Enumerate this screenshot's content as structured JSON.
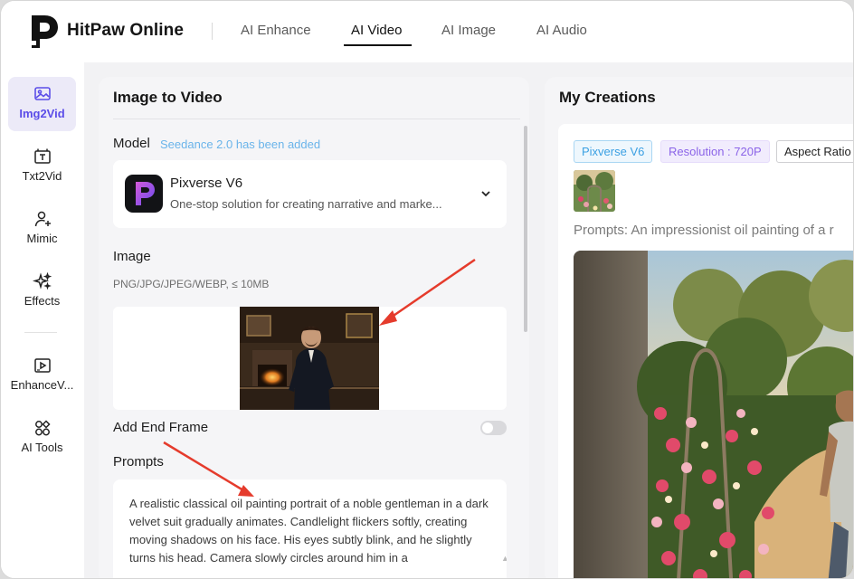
{
  "header": {
    "brand": "HitPaw Online",
    "tabs": [
      {
        "label": "AI Enhance"
      },
      {
        "label": "AI Video"
      },
      {
        "label": "AI Image"
      },
      {
        "label": "AI Audio"
      }
    ],
    "active_tab": "AI Video"
  },
  "sidebar": {
    "items": [
      {
        "label": "Img2Vid",
        "icon": "image-icon"
      },
      {
        "label": "Txt2Vid",
        "icon": "text-frame-icon"
      },
      {
        "label": "Mimic",
        "icon": "person-sparkle-icon"
      },
      {
        "label": "Effects",
        "icon": "sparkles-icon"
      },
      {
        "label": "EnhanceV...",
        "icon": "hd-video-icon"
      },
      {
        "label": "AI Tools",
        "icon": "tools-grid-icon"
      }
    ],
    "active_item": "Img2Vid"
  },
  "image_to_video": {
    "title": "Image to Video",
    "model_label": "Model",
    "model_note": "Seedance 2.0 has been added",
    "model": {
      "name": "Pixverse V6",
      "description": "One-stop solution for creating narrative and marke..."
    },
    "image_label": "Image",
    "image_hint": "PNG/JPG/JPEG/WEBP, ≤ 10MB",
    "end_frame_label": "Add End Frame",
    "end_frame_enabled": false,
    "prompts_label": "Prompts",
    "prompt_text": "A realistic classical oil painting portrait of a noble gentleman in a dark velvet suit gradually animates. Candlelight flickers softly, creating moving shadows on his face. His eyes subtly blink, and he slightly turns his head. Camera slowly circles around him in a"
  },
  "my_creations": {
    "title": "My Creations",
    "chips": {
      "model": "Pixverse V6",
      "resolution": "Resolution : 720P",
      "aspect": "Aspect Ratio"
    },
    "prompt_line": "Prompts: An impressionist oil painting of a r"
  },
  "colors": {
    "accent": "#5b4de8",
    "note_blue": "#6ab4ea",
    "annotation_red": "#e53b2c"
  }
}
